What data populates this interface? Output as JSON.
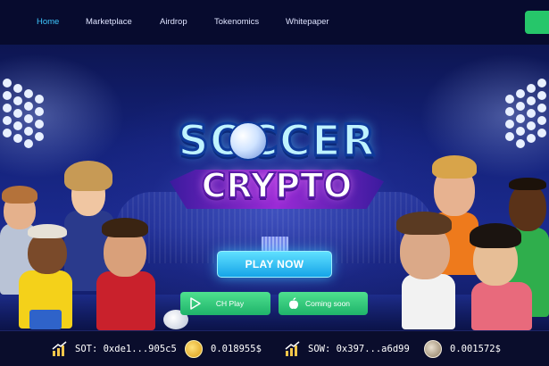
{
  "nav": {
    "items": [
      {
        "label": "Home",
        "active": true
      },
      {
        "label": "Marketplace",
        "active": false
      },
      {
        "label": "Airdrop",
        "active": false
      },
      {
        "label": "Tokenomics",
        "active": false
      },
      {
        "label": "Whitepaper",
        "active": false
      }
    ],
    "active_color": "#3ec8ff",
    "cta_color": "#26c66a"
  },
  "hero": {
    "logo_line1": "SOCCER",
    "logo_line2": "CRYPTO",
    "play_button": "PLAY NOW",
    "store_buttons": [
      {
        "label": "CH Play",
        "icon": "play-store-icon"
      },
      {
        "label": "Coming soon",
        "icon": "apple-icon"
      }
    ],
    "accent_color": "#16a4e8",
    "store_color": "#1fb36a"
  },
  "ticker": {
    "items": [
      {
        "icon": "chart-up-icon",
        "text": "SOT: 0xde1...905c5"
      },
      {
        "icon": "sot-coin-icon",
        "text": "0.018955$"
      },
      {
        "icon": "chart-up-icon",
        "text": "SOW: 0x397...a6d99"
      },
      {
        "icon": "sow-coin-icon",
        "text": "0.001572$"
      }
    ]
  }
}
